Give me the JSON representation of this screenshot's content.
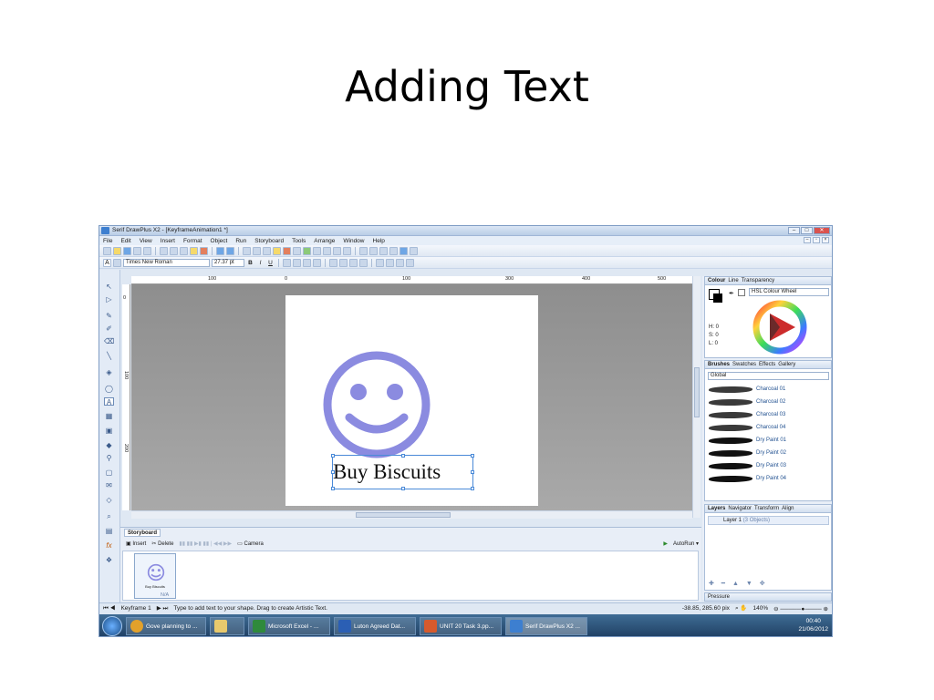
{
  "slide": {
    "title": "Adding Text"
  },
  "app": {
    "window_title": "Serif DrawPlus X2 - [KeyframeAnimation1 *]",
    "menu": [
      "File",
      "Edit",
      "View",
      "Insert",
      "Format",
      "Object",
      "Run",
      "Storyboard",
      "Tools",
      "Arrange",
      "Window",
      "Help"
    ],
    "font": {
      "family": "Times New Roman",
      "size": "27.37 pt"
    },
    "format_buttons": {
      "bold": "B",
      "italic": "I",
      "underline": "U"
    },
    "ruler": {
      "h_labels": [
        "100",
        "0",
        "100",
        "300",
        "400",
        "500"
      ],
      "v_labels": [
        "0",
        "100",
        "200"
      ]
    },
    "canvas": {
      "text": "Buy Biscuits",
      "smiley_color": "#8b8be0"
    },
    "colour_panel": {
      "tabs": [
        "Colour",
        "Line",
        "Transparency"
      ],
      "mode": "HSL Colour Wheel",
      "values": [
        "H: 0",
        "S: 0",
        "L: 0"
      ]
    },
    "brushes_panel": {
      "tabs": [
        "Brushes",
        "Swatches",
        "Effects",
        "Gallery"
      ],
      "category": "Global",
      "items": [
        "Charcoal 01",
        "Charcoal 02",
        "Charcoal 03",
        "Charcoal 04",
        "Dry Paint 01",
        "Dry Paint 02",
        "Dry Paint 03",
        "Dry Paint 04"
      ]
    },
    "layers_panel": {
      "tabs": [
        "Layers",
        "Navigator",
        "Transform",
        "Align"
      ],
      "layer": "Layer 1",
      "objects": "(3 Objects)"
    },
    "pressure_label": "Pressure",
    "storyboard": {
      "title": "Storyboard",
      "insert": "Insert",
      "delete": "Delete",
      "camera": "Camera",
      "autorun": "AutoRun",
      "frame_caption": "Buy Biscuits",
      "frame_duration": "N/A"
    },
    "status": {
      "keyframe": "Keyframe 1",
      "hint": "Type to add text to your shape. Drag to create Artistic Text.",
      "coords": "-38.85, 285.60 pix",
      "zoom": "140%"
    }
  },
  "taskbar": {
    "items": [
      {
        "label": "Gove planning to ...",
        "color": "#e2a12b"
      },
      {
        "label": "",
        "color": "#e8c96d"
      },
      {
        "label": "Microsoft Excel - ...",
        "color": "#2f8a3c"
      },
      {
        "label": "Luton Agreed Dat...",
        "color": "#2b5fb4"
      },
      {
        "label": "UNIT 20 Task 3.pp...",
        "color": "#d65a2d"
      },
      {
        "label": "Serif DrawPlus X2 ...",
        "color": "#3d7fd0"
      }
    ],
    "time": "00:40",
    "date": "21/06/2012"
  }
}
